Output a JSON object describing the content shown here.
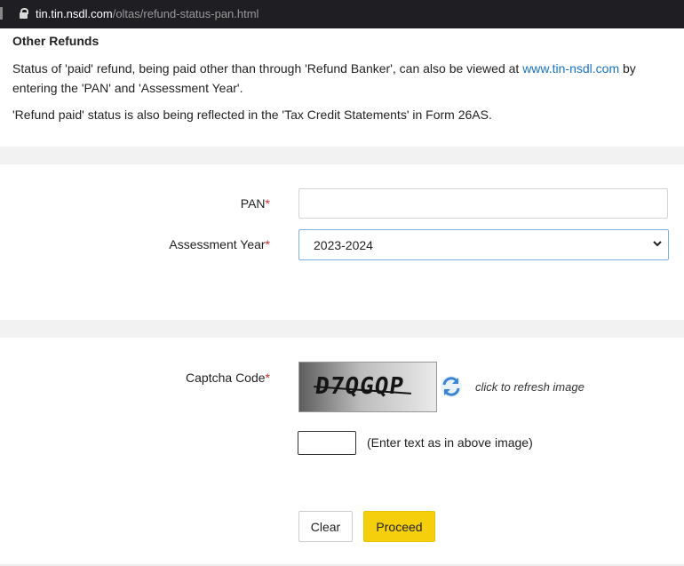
{
  "browser": {
    "url_host": "tin.tin.nsdl.com",
    "url_path": "/oltas/refund-status-pan.html",
    "lock_icon": "lock-icon"
  },
  "other_refunds": {
    "title": "Other Refunds",
    "para1_a": "Status of 'paid' refund, being paid other than through 'Refund Banker', can also be viewed at ",
    "para1_link": "www.tin-nsdl.com",
    "para1_b": " by entering the 'PAN' and 'Assessment Year'.",
    "para2": "'Refund paid' status is also being reflected in the 'Tax Credit Statements' in Form 26AS."
  },
  "form": {
    "pan_label": "PAN",
    "pan_value": "",
    "required_mark": "*",
    "ay_label": "Assessment Year",
    "ay_value": "2023-2024"
  },
  "captcha": {
    "label": "Captcha Code",
    "image_text": "D7QGQP",
    "refresh_text": "click to refresh image",
    "input_value": "",
    "hint": "(Enter text as in above image)",
    "refresh_icon": "refresh-icon"
  },
  "buttons": {
    "clear": "Clear",
    "proceed": "Proceed"
  },
  "colors": {
    "link": "#1a73c8",
    "required": "#d9262c",
    "proceed_bg": "#f5cf0c",
    "select_border": "#7fb0e4"
  }
}
